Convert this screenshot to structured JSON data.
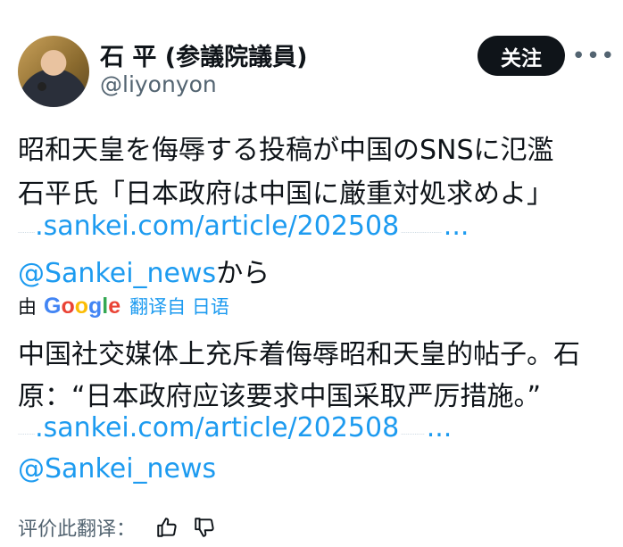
{
  "author": {
    "display_name": "石 平 (参議院議員)",
    "handle": "@liyonyon"
  },
  "follow_label": "关注",
  "more_label": "•••",
  "post": {
    "line1": "昭和天皇を侮辱する投稿が中国のSNSに氾濫",
    "line2": "石平氏「日本政府は中国に厳重対処求めよ」",
    "link_text": ".sankei.com/article/202508",
    "link_ellipsis": "...",
    "mention": "@Sankei_news",
    "mention_suffix": "から"
  },
  "translation": {
    "by_label": "由",
    "provider": "Google",
    "provider_colors": [
      "#4285F4",
      "#EA4335",
      "#FBBC05",
      "#4285F4",
      "#34A853",
      "#EA4335"
    ],
    "translated_from": "翻译自 日语",
    "line1": "中国社交媒体上充斥着侮辱昭和天皇的帖子。石",
    "line2": "原：“日本政府应该要求中国采取严厉措施。”",
    "link_text": ".sankei.com/article/202508",
    "link_ellipsis": "...",
    "mention": "@Sankei_news"
  },
  "rating": {
    "label": "评价此翻译：",
    "thumbs_up_icon": "thumbs-up-icon",
    "thumbs_down_icon": "thumbs-down-icon"
  }
}
